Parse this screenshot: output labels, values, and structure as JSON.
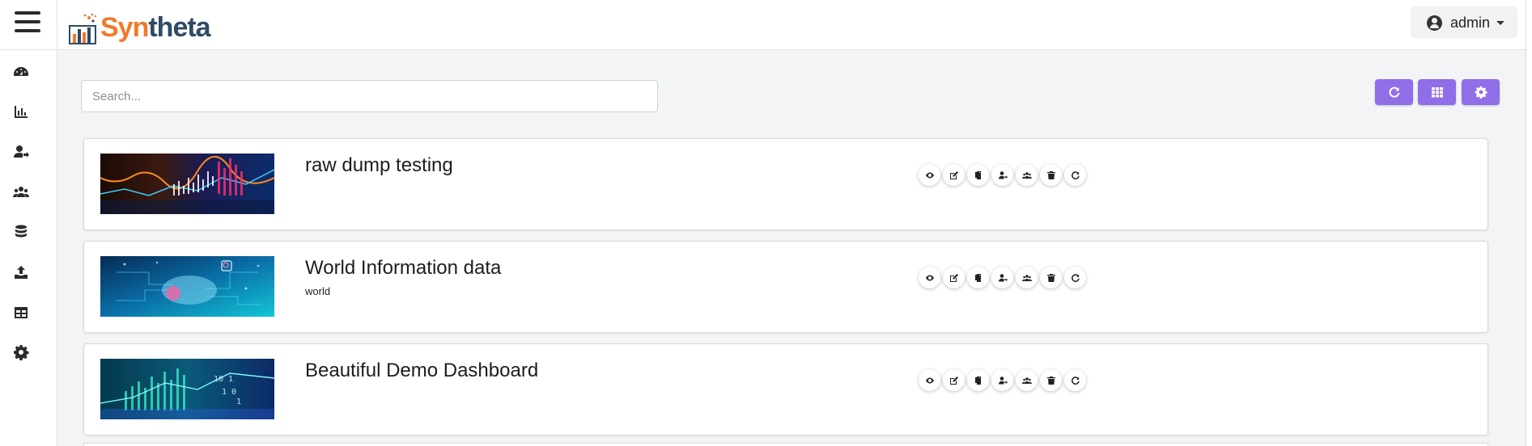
{
  "header": {
    "logo_part1": "Syn",
    "logo_part2": "theta",
    "user_name": "admin",
    "menu_icon": "hamburger-icon",
    "user_icon": "user-circle-icon",
    "dropdown_icon": "caret-down-icon"
  },
  "sidebar": {
    "items": [
      {
        "icon": "dashboard-icon"
      },
      {
        "icon": "chart-icon"
      },
      {
        "icon": "user-share-icon"
      },
      {
        "icon": "users-icon"
      },
      {
        "icon": "database-icon"
      },
      {
        "icon": "upload-icon"
      },
      {
        "icon": "table-icon"
      },
      {
        "icon": "settings-icon"
      }
    ]
  },
  "search": {
    "placeholder": "Search..."
  },
  "toolbar": {
    "buttons": [
      {
        "icon": "refresh-icon"
      },
      {
        "icon": "grid-icon"
      },
      {
        "icon": "settings-icon"
      }
    ],
    "accent_color": "#8f6ee8"
  },
  "dashboards": [
    {
      "title": "raw dump testing",
      "subtitle": "",
      "thumbnail": "orange-finance-chart"
    },
    {
      "title": "World Information data",
      "subtitle": "world",
      "thumbnail": "cyan-cloud-network"
    },
    {
      "title": "Beautiful Demo Dashboard",
      "subtitle": "",
      "thumbnail": "teal-data-bars"
    }
  ],
  "card_actions": [
    {
      "icon": "eye-icon"
    },
    {
      "icon": "edit-icon"
    },
    {
      "icon": "copy-icon"
    },
    {
      "icon": "user-share-icon"
    },
    {
      "icon": "users-icon"
    },
    {
      "icon": "trash-icon"
    },
    {
      "icon": "refresh-icon"
    }
  ]
}
